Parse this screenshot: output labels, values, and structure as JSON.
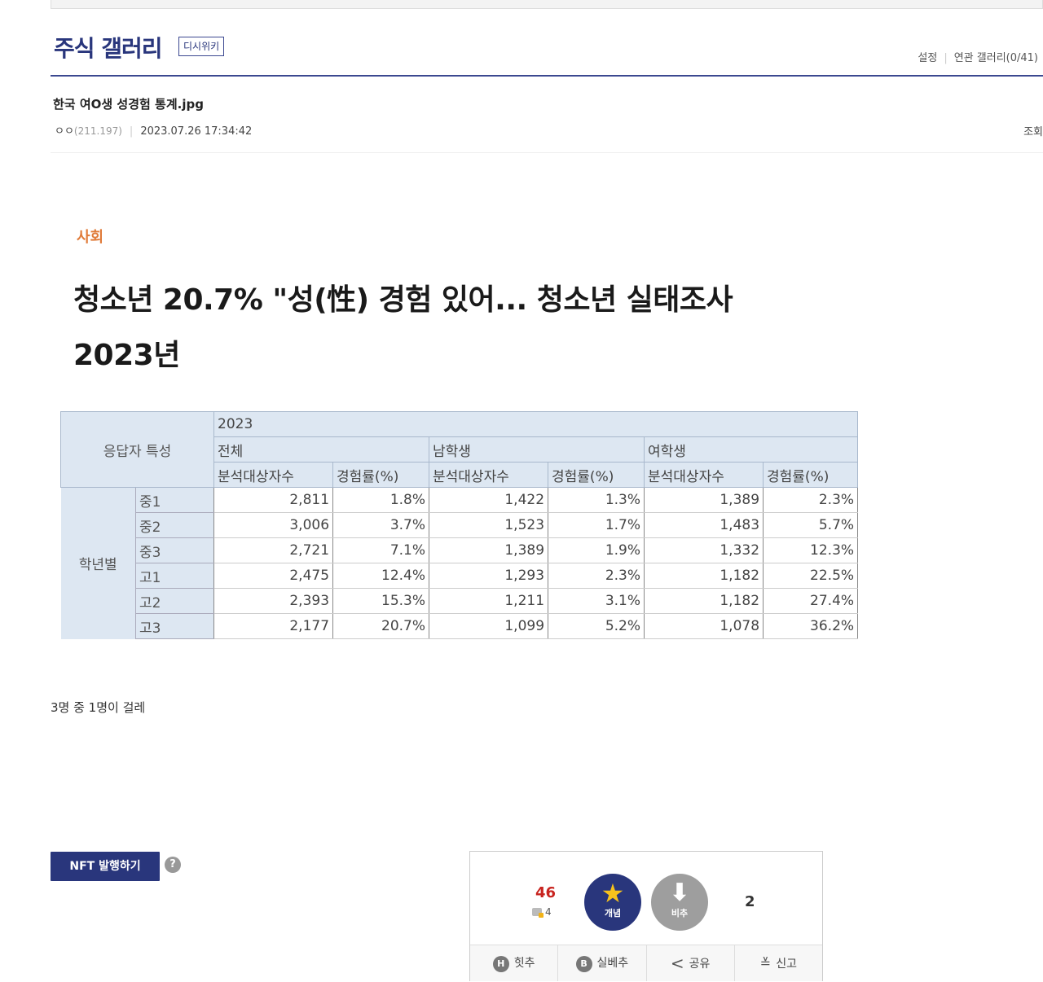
{
  "gallery": {
    "title": "주식 갤러리",
    "wiki_label": "디시위키",
    "links": [
      "설정",
      "연관 갤러리(0/41)"
    ]
  },
  "post": {
    "title": "한국 여O생 성경험 통계.jpg",
    "author": "ㅇㅇ",
    "ip": "(211.197)",
    "datetime": "2023.07.26 17:34:42",
    "views_label": "조회",
    "body_text": "3명 중 1명이 걸레"
  },
  "news_image": {
    "category": "사회",
    "headline_line1": "청소년 20.7% \"성(性) 경험 있어... 청소년 실태조사",
    "headline_line2": "2023년",
    "table": {
      "year": "2023",
      "respondent_label": "응답자 특성",
      "groups": [
        "전체",
        "남학생",
        "여학생"
      ],
      "subheaders": [
        "분석대상자수",
        "경험률(%)",
        "분석대상자수",
        "경험률(%)",
        "분석대상자수",
        "경험률(%)"
      ],
      "row_group": "학년별",
      "rows": [
        {
          "grade": "중1",
          "values": [
            "2,811",
            "1.8%",
            "1,422",
            "1.3%",
            "1,389",
            "2.3%"
          ]
        },
        {
          "grade": "중2",
          "values": [
            "3,006",
            "3.7%",
            "1,523",
            "1.7%",
            "1,483",
            "5.7%"
          ]
        },
        {
          "grade": "중3",
          "values": [
            "2,721",
            "7.1%",
            "1,389",
            "1.9%",
            "1,332",
            "12.3%"
          ]
        },
        {
          "grade": "고1",
          "values": [
            "2,475",
            "12.4%",
            "1,293",
            "2.3%",
            "1,182",
            "22.5%"
          ]
        },
        {
          "grade": "고2",
          "values": [
            "2,393",
            "15.3%",
            "1,211",
            "3.1%",
            "1,182",
            "27.4%"
          ]
        },
        {
          "grade": "고3",
          "values": [
            "2,177",
            "20.7%",
            "1,099",
            "5.2%",
            "1,078",
            "36.2%"
          ]
        }
      ]
    }
  },
  "nft": {
    "button_label": "NFT 발행하기",
    "help_glyph": "?"
  },
  "vote": {
    "up_count": "46",
    "fix_count": "4",
    "up_label": "개념",
    "down_label": "비추",
    "down_count": "2",
    "actions": [
      {
        "label": "힛추",
        "icon": "hit-icon",
        "glyph": "H"
      },
      {
        "label": "실베추",
        "icon": "best-icon",
        "glyph": "B"
      },
      {
        "label": "공유",
        "icon": "share-icon",
        "glyph": "<"
      },
      {
        "label": "신고",
        "icon": "siren-icon",
        "glyph": "≚"
      }
    ]
  },
  "colors": {
    "brand": "#29367c",
    "up_count": "#c8241f",
    "star": "#f7c21c",
    "category": "#e07b39"
  }
}
